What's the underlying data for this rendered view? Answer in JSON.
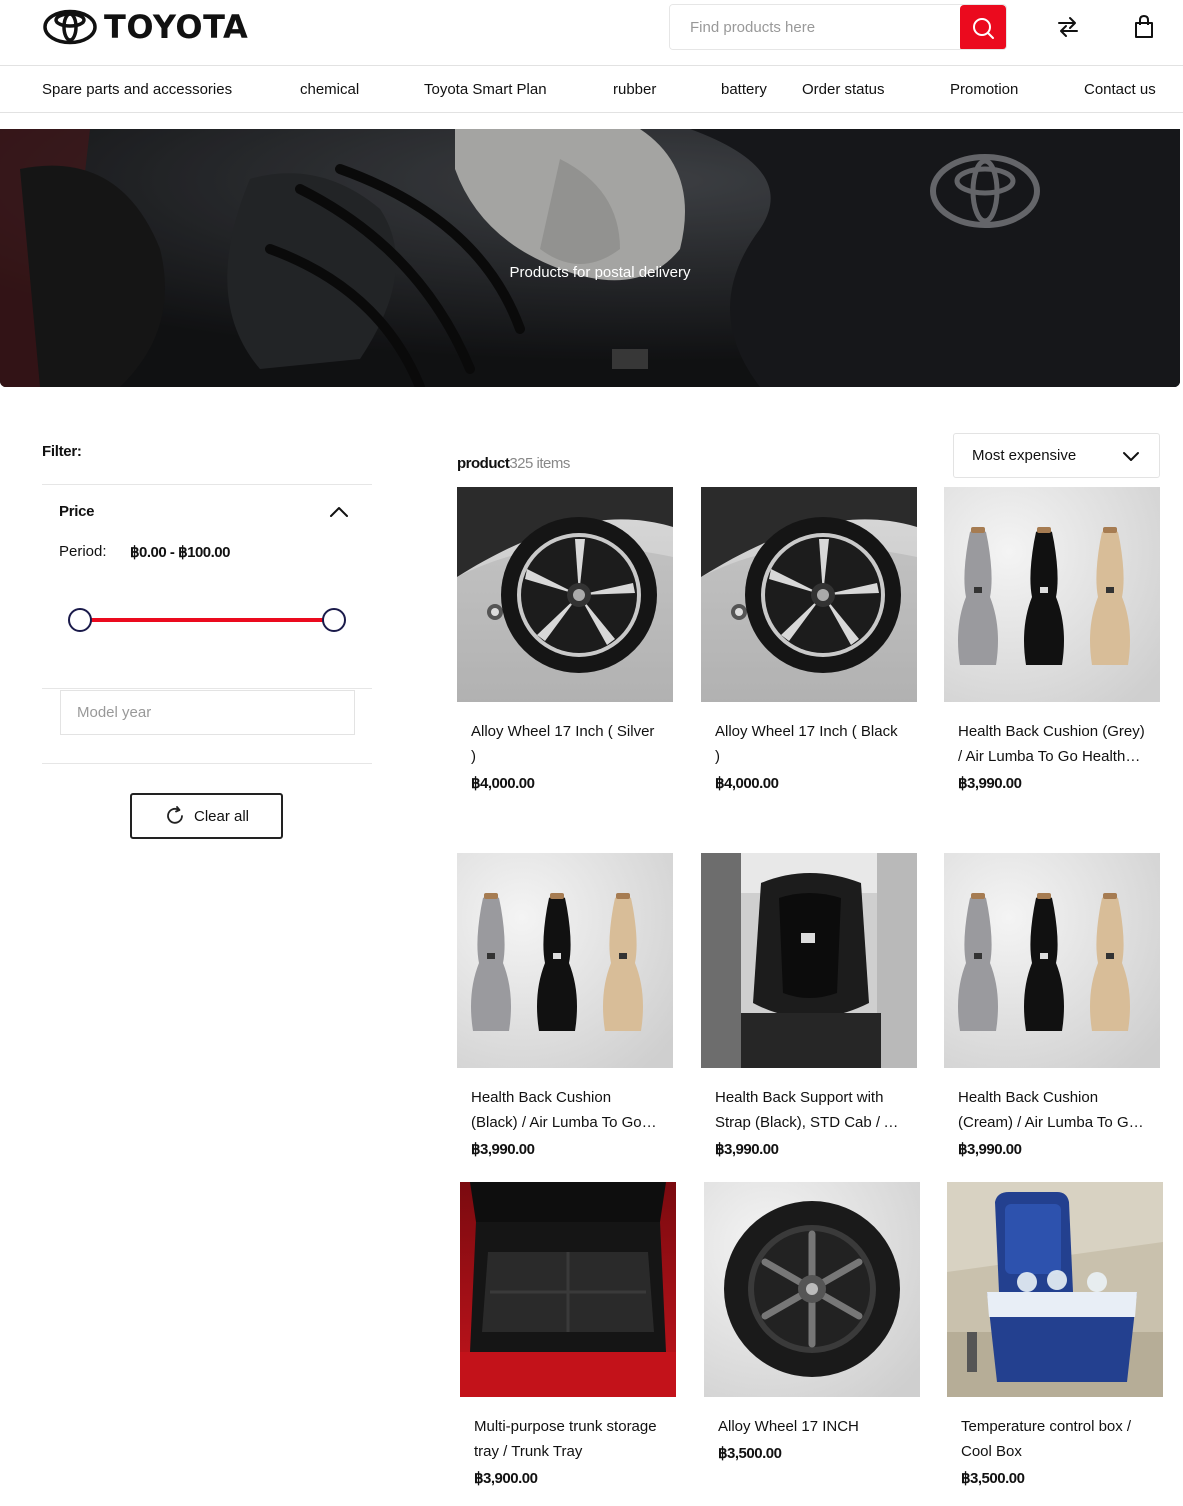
{
  "header": {
    "brand": "TOYOTA",
    "search_placeholder": "Find products here"
  },
  "nav": {
    "items": [
      {
        "label": "Spare parts and accessories"
      },
      {
        "label": "chemical"
      },
      {
        "label": "Toyota Smart Plan"
      },
      {
        "label": "rubber"
      },
      {
        "label": "battery"
      },
      {
        "label": "Order status"
      },
      {
        "label": "Promotion"
      },
      {
        "label": "Contact us"
      }
    ]
  },
  "banner": {
    "title": "Products for postal delivery"
  },
  "filter": {
    "label": "Filter:",
    "price": {
      "heading": "Price",
      "period_label": "Period:",
      "period_value": "฿0.00 - ฿100.00"
    },
    "model_year_placeholder": "Model year",
    "clear_label": "Clear all"
  },
  "products": {
    "heading": "product",
    "count": "325 items",
    "sort": "Most expensive",
    "items": [
      {
        "name": "Alloy Wheel 17 Inch ( Silver )",
        "price": "฿4,000.00",
        "image": "wheel-closeup"
      },
      {
        "name": "Alloy Wheel 17 Inch ( Black )",
        "price": "฿4,000.00",
        "image": "wheel-closeup"
      },
      {
        "name": "Health Back Cushion (Grey) / Air Lumba To Go Health Cushion",
        "price": "฿3,990.00",
        "image": "cushions-trio"
      },
      {
        "name": "Health Back Cushion (Black) / Air Lumba To Go Health Cushion",
        "price": "฿3,990.00",
        "image": "cushions-trio"
      },
      {
        "name": "Health Back Support with Strap (Black), STD Cab / Air Lumba",
        "price": "฿3,990.00",
        "image": "seat-cushion"
      },
      {
        "name": "Health Back Cushion (Cream) / Air Lumba To Go Health Cushion",
        "price": "฿3,990.00",
        "image": "cushions-trio"
      },
      {
        "name": "Multi-purpose trunk storage tray / Trunk Tray",
        "price": "฿3,900.00",
        "image": "trunk-tray"
      },
      {
        "name": "Alloy Wheel 17 INCH",
        "price": "฿3,500.00",
        "image": "wheel-tire"
      },
      {
        "name": "Temperature control box / Cool Box",
        "price": "฿3,500.00",
        "image": "cool-box"
      }
    ]
  },
  "colors": {
    "accent": "#eb0a1e",
    "text": "#111111",
    "muted": "#888888",
    "border": "#e3e3e3"
  }
}
